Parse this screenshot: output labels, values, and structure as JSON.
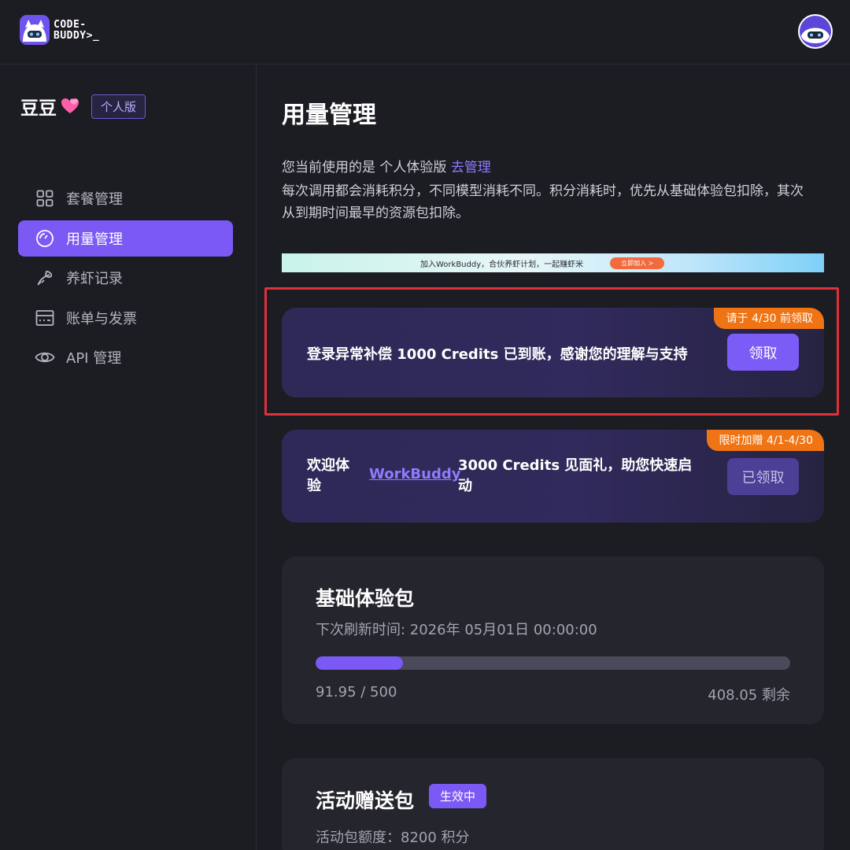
{
  "brand": {
    "line1": "CODE-",
    "line2": "BUDDY>_"
  },
  "colors": {
    "accent": "#7a59f4",
    "orange": "#f07414",
    "highlight": "#e0313a",
    "background": "#1c1c23"
  },
  "sidebar": {
    "user_name": "豆豆",
    "plan_badge": "个人版",
    "items": [
      {
        "label": "套餐管理",
        "icon": "grid-icon",
        "active": false
      },
      {
        "label": "用量管理",
        "icon": "gauge-icon",
        "active": true
      },
      {
        "label": "养虾记录",
        "icon": "shrimp-icon",
        "active": false
      },
      {
        "label": "账单与发票",
        "icon": "invoice-icon",
        "active": false
      },
      {
        "label": "API 管理",
        "icon": "eye-icon",
        "active": false
      }
    ]
  },
  "main": {
    "title": "用量管理",
    "desc_prefix": "您当前使用的是 个人体验版 ",
    "desc_link": "去管理",
    "desc2": "每次调用都会消耗积分，不同模型消耗不同。积分消耗时，优先从基础体验包扣除，其次从到期时间最早的资源包扣除。",
    "banner": {
      "text": "加入WorkBuddy，合伙养虾计划，一起赚虾米",
      "button": "立即加入 >"
    },
    "promo1": {
      "tag": "请于 4/30 前领取",
      "text": "登录异常补偿 1000 Credits 已到账，感谢您的理解与支持",
      "button": "领取"
    },
    "promo2": {
      "tag": "限时加赠 4/1-4/30",
      "text_a": "欢迎体验",
      "link": "WorkBuddy",
      "text_b": "3000 Credits 见面礼，助您快速启动",
      "button": "已领取"
    },
    "basic_pack": {
      "title": "基础体验包",
      "refresh_label": "下次刷新时间: 2026年 05月01日 00:00:00",
      "used_text": "91.95 / 500",
      "remain_text": "408.05 剩余",
      "used": 91.95,
      "total": 500
    },
    "activity_pack": {
      "title": "活动赠送包",
      "status": "生效中",
      "quota_label": "活动包额度：8200 积分"
    }
  }
}
